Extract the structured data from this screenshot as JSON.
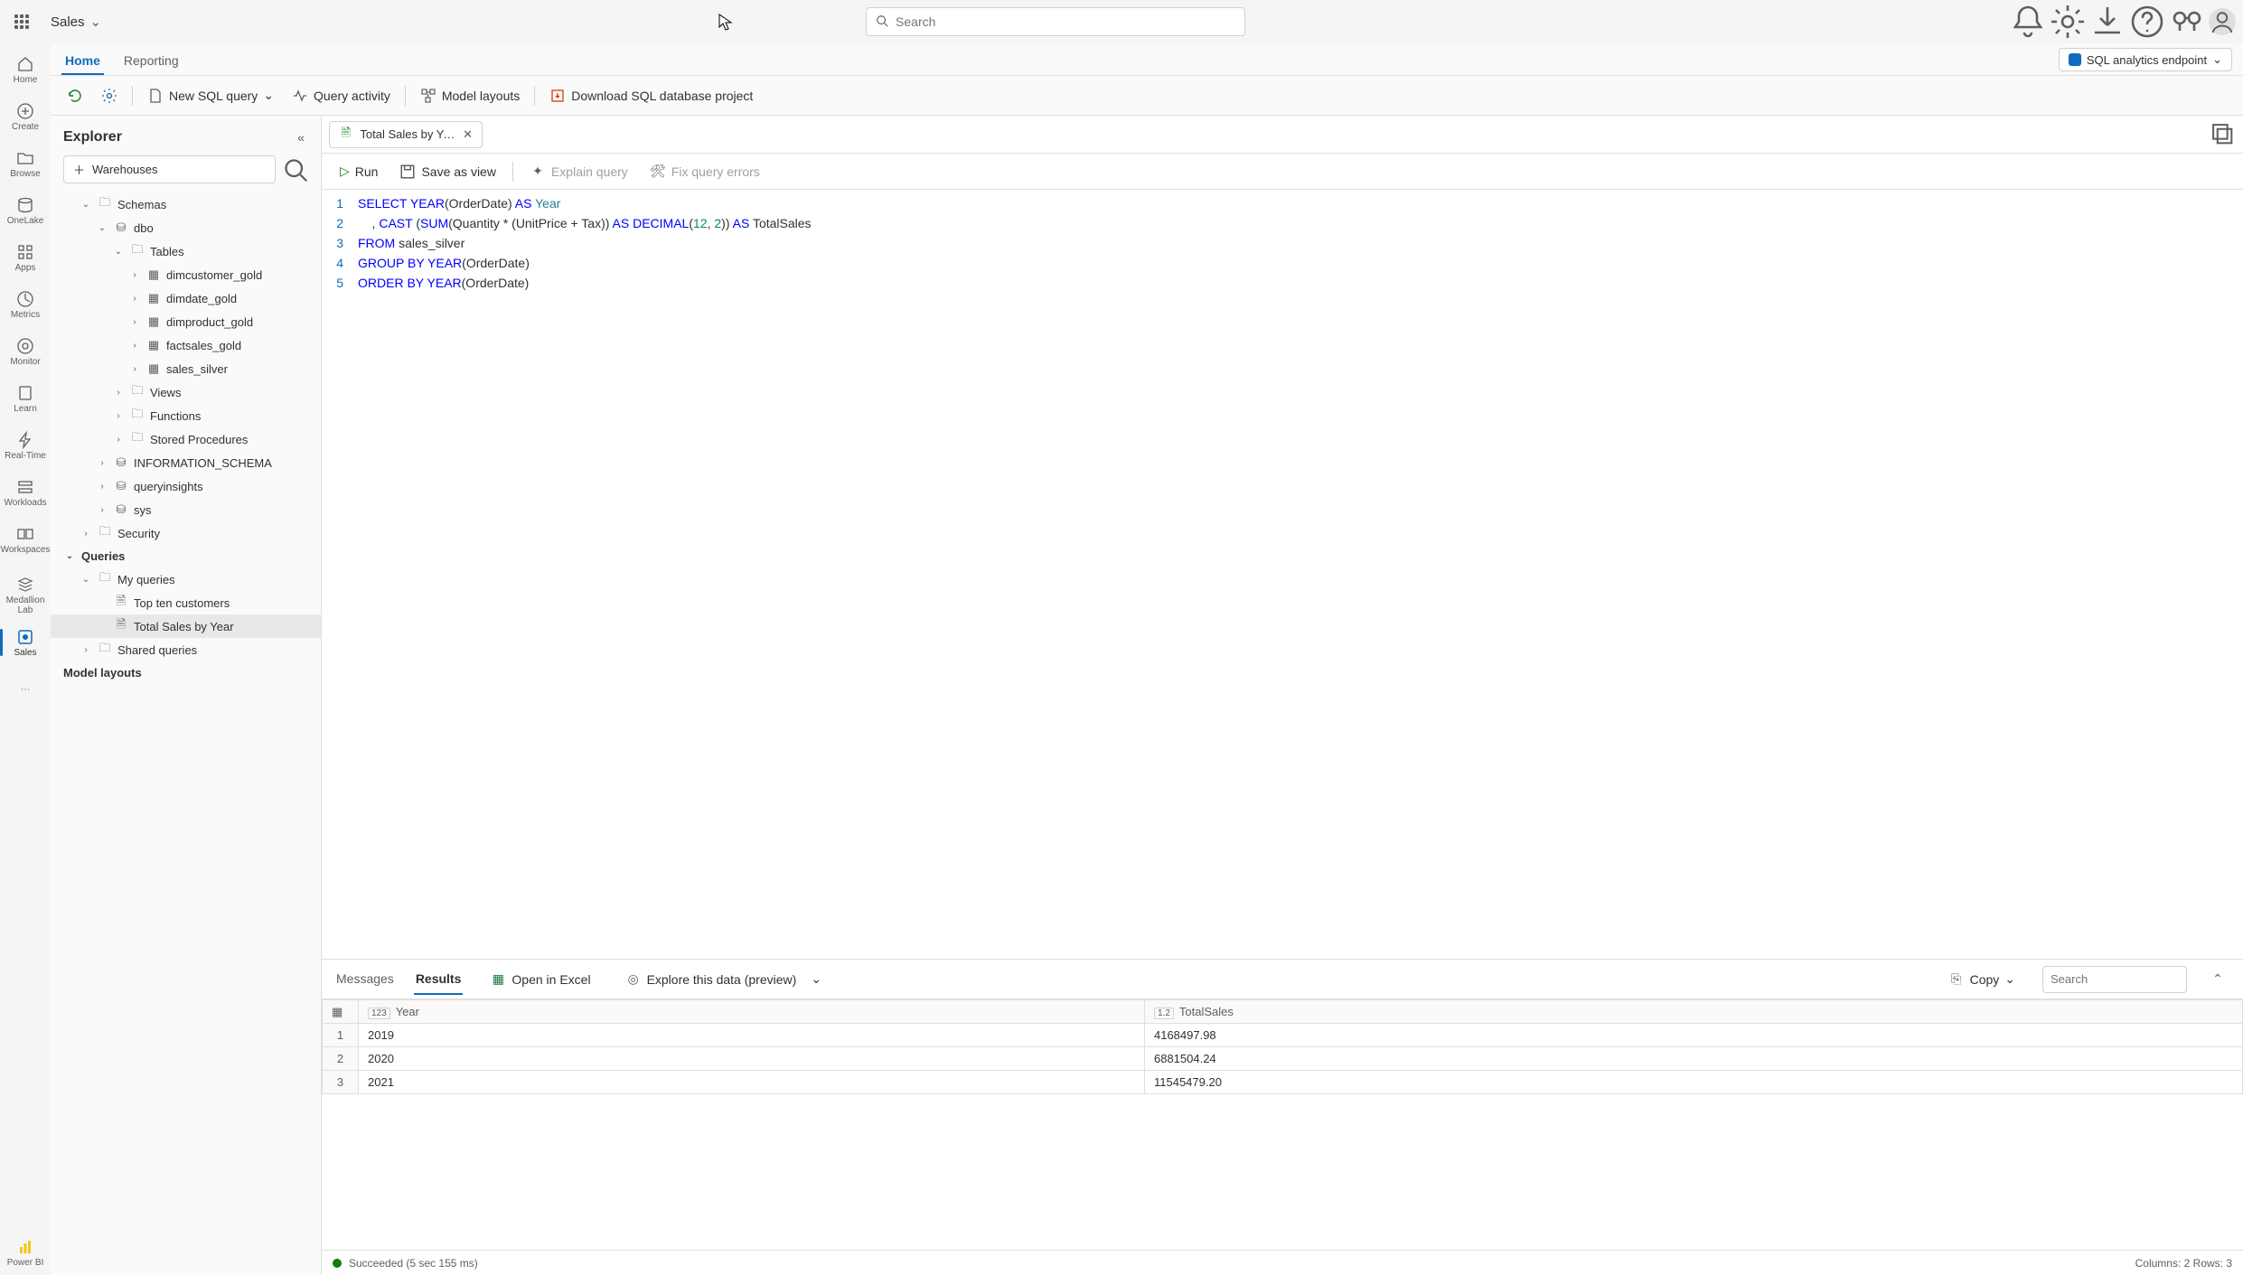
{
  "topbar": {
    "breadcrumb": "Sales",
    "search_placeholder": "Search"
  },
  "tabs": {
    "home": "Home",
    "reporting": "Reporting",
    "endpoint": "SQL analytics endpoint"
  },
  "toolbar": {
    "new_query": "New SQL query",
    "query_activity": "Query activity",
    "model_layouts": "Model layouts",
    "download_project": "Download SQL database project"
  },
  "rail": {
    "home": "Home",
    "create": "Create",
    "browse": "Browse",
    "onelake": "OneLake",
    "apps": "Apps",
    "metrics": "Metrics",
    "monitor": "Monitor",
    "learn": "Learn",
    "realtime": "Real-Time",
    "workloads": "Workloads",
    "workspaces": "Workspaces",
    "medallion": "Medallion Lab",
    "sales": "Sales",
    "powerbi": "Power BI"
  },
  "explorer": {
    "title": "Explorer",
    "warehouses": "Warehouses",
    "schemas": "Schemas",
    "dbo": "dbo",
    "tables": "Tables",
    "table_list": [
      "dimcustomer_gold",
      "dimdate_gold",
      "dimproduct_gold",
      "factsales_gold",
      "sales_silver"
    ],
    "views": "Views",
    "functions": "Functions",
    "stored_procs": "Stored Procedures",
    "info_schema": "INFORMATION_SCHEMA",
    "queryinsights": "queryinsights",
    "sys": "sys",
    "security": "Security",
    "queries": "Queries",
    "my_queries": "My queries",
    "q1": "Top ten customers",
    "q2": "Total Sales by Year",
    "shared_queries": "Shared queries",
    "model_layouts": "Model layouts"
  },
  "file_tab": {
    "label": "Total Sales by Ye..."
  },
  "query_tb": {
    "run": "Run",
    "save_view": "Save as view",
    "explain": "Explain query",
    "fix": "Fix query errors"
  },
  "sql": {
    "l1a": "SELECT",
    "l1b": "YEAR",
    "l1c": "(OrderDate)",
    "l1d": "AS",
    "l1e": "Year",
    "l2a": "    , ",
    "l2b": "CAST",
    "l2c": " (",
    "l2d": "SUM",
    "l2e": "(Quantity * (UnitPrice + Tax))",
    "l2f": " AS ",
    "l2g": "DECIMAL",
    "l2h": "(",
    "l2i": "12",
    "l2j": ", ",
    "l2k": "2",
    "l2l": "))",
    "l2m": " AS ",
    "l2n": "TotalSales",
    "l3a": "FROM",
    "l3b": " sales_silver",
    "l4a": "GROUP",
    "l4b": " BY ",
    "l4c": "YEAR",
    "l4d": "(OrderDate)",
    "l5a": "ORDER",
    "l5b": " BY ",
    "l5c": "YEAR",
    "l5d": "(OrderDate)"
  },
  "line_nums": [
    "1",
    "2",
    "3",
    "4",
    "5"
  ],
  "results": {
    "messages": "Messages",
    "results": "Results",
    "open_excel": "Open in Excel",
    "explore": "Explore this data (preview)",
    "copy": "Copy",
    "search_placeholder": "Search",
    "col1": "Year",
    "col2": "TotalSales",
    "col1_type": "123",
    "col2_type": "1.2",
    "rows": [
      {
        "n": "1",
        "year": "2019",
        "total": "4168497.98"
      },
      {
        "n": "2",
        "year": "2020",
        "total": "6881504.24"
      },
      {
        "n": "3",
        "year": "2021",
        "total": "11545479.20"
      }
    ]
  },
  "status": {
    "text": "Succeeded (5 sec 155 ms)",
    "meta": "Columns: 2 Rows: 3"
  }
}
